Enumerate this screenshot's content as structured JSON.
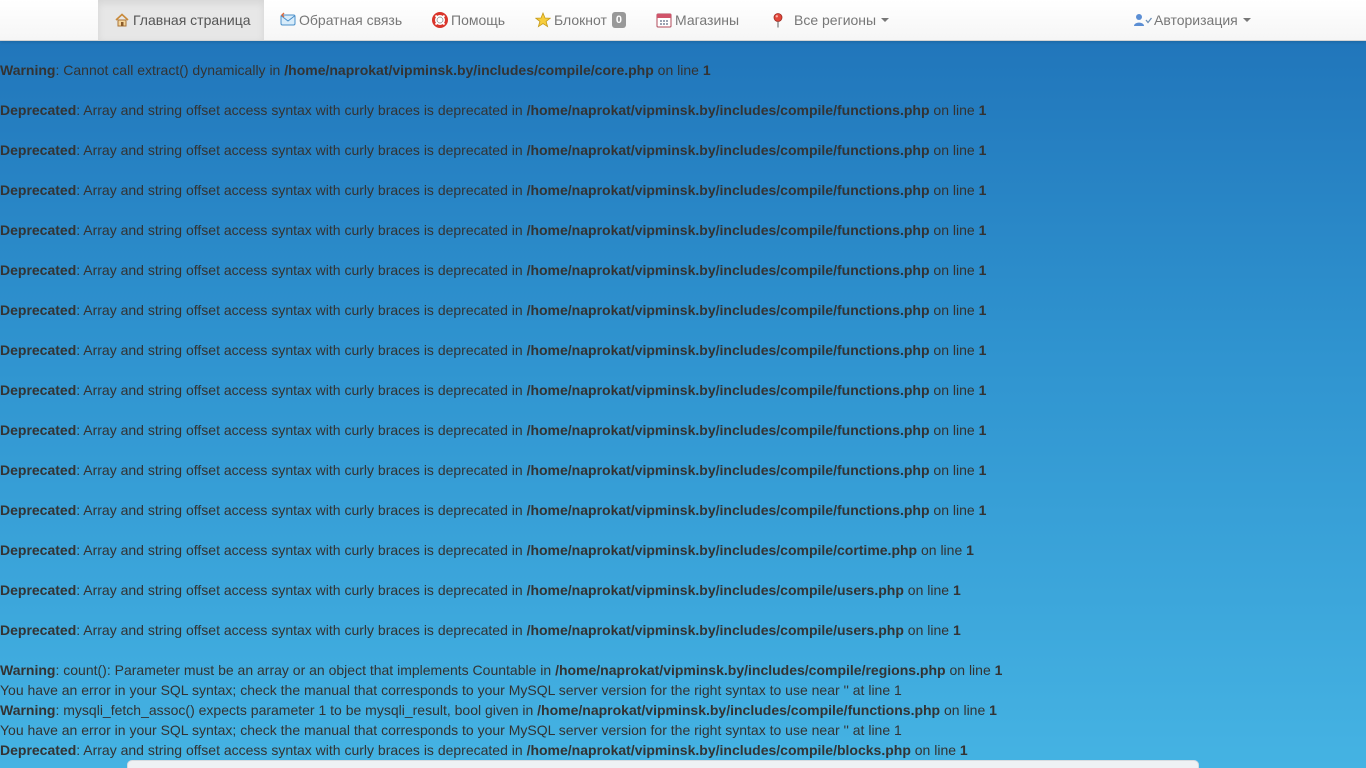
{
  "navbar": {
    "items": [
      {
        "label": "Главная страница",
        "icon": "home-icon",
        "active": true
      },
      {
        "label": "Обратная связь",
        "icon": "feedback-icon",
        "active": false
      },
      {
        "label": "Помощь",
        "icon": "lifebuoy-icon",
        "active": false
      },
      {
        "label": "Блокнот",
        "icon": "star-icon",
        "active": false,
        "badge": "0"
      },
      {
        "label": "Магазины",
        "icon": "calendar-icon",
        "active": false
      },
      {
        "label": "Все регионы",
        "icon": "map-pin-icon",
        "active": false,
        "dropdown": true
      }
    ],
    "auth": {
      "label": "Авторизация",
      "icon": "user-icon",
      "dropdown": true
    }
  },
  "messages": [
    {
      "type": "Warning",
      "text": ": Cannot call extract() dynamically in ",
      "file": "/home/naprokat/vipminsk.by/includes/compile/core.php",
      "on": " on line ",
      "line": "1"
    },
    {
      "type": "Deprecated",
      "text": ": Array and string offset access syntax with curly braces is deprecated in ",
      "file": "/home/naprokat/vipminsk.by/includes/compile/functions.php",
      "on": " on line ",
      "line": "1"
    },
    {
      "type": "Deprecated",
      "text": ": Array and string offset access syntax with curly braces is deprecated in ",
      "file": "/home/naprokat/vipminsk.by/includes/compile/functions.php",
      "on": " on line ",
      "line": "1"
    },
    {
      "type": "Deprecated",
      "text": ": Array and string offset access syntax with curly braces is deprecated in ",
      "file": "/home/naprokat/vipminsk.by/includes/compile/functions.php",
      "on": " on line ",
      "line": "1"
    },
    {
      "type": "Deprecated",
      "text": ": Array and string offset access syntax with curly braces is deprecated in ",
      "file": "/home/naprokat/vipminsk.by/includes/compile/functions.php",
      "on": " on line ",
      "line": "1"
    },
    {
      "type": "Deprecated",
      "text": ": Array and string offset access syntax with curly braces is deprecated in ",
      "file": "/home/naprokat/vipminsk.by/includes/compile/functions.php",
      "on": " on line ",
      "line": "1"
    },
    {
      "type": "Deprecated",
      "text": ": Array and string offset access syntax with curly braces is deprecated in ",
      "file": "/home/naprokat/vipminsk.by/includes/compile/functions.php",
      "on": " on line ",
      "line": "1"
    },
    {
      "type": "Deprecated",
      "text": ": Array and string offset access syntax with curly braces is deprecated in ",
      "file": "/home/naprokat/vipminsk.by/includes/compile/functions.php",
      "on": " on line ",
      "line": "1"
    },
    {
      "type": "Deprecated",
      "text": ": Array and string offset access syntax with curly braces is deprecated in ",
      "file": "/home/naprokat/vipminsk.by/includes/compile/functions.php",
      "on": " on line ",
      "line": "1"
    },
    {
      "type": "Deprecated",
      "text": ": Array and string offset access syntax with curly braces is deprecated in ",
      "file": "/home/naprokat/vipminsk.by/includes/compile/functions.php",
      "on": " on line ",
      "line": "1"
    },
    {
      "type": "Deprecated",
      "text": ": Array and string offset access syntax with curly braces is deprecated in ",
      "file": "/home/naprokat/vipminsk.by/includes/compile/functions.php",
      "on": " on line ",
      "line": "1"
    },
    {
      "type": "Deprecated",
      "text": ": Array and string offset access syntax with curly braces is deprecated in ",
      "file": "/home/naprokat/vipminsk.by/includes/compile/functions.php",
      "on": " on line ",
      "line": "1"
    },
    {
      "type": "Deprecated",
      "text": ": Array and string offset access syntax with curly braces is deprecated in ",
      "file": "/home/naprokat/vipminsk.by/includes/compile/cortime.php",
      "on": " on line ",
      "line": "1"
    },
    {
      "type": "Deprecated",
      "text": ": Array and string offset access syntax with curly braces is deprecated in ",
      "file": "/home/naprokat/vipminsk.by/includes/compile/users.php",
      "on": " on line ",
      "line": "1"
    },
    {
      "type": "Deprecated",
      "text": ": Array and string offset access syntax with curly braces is deprecated in ",
      "file": "/home/naprokat/vipminsk.by/includes/compile/users.php",
      "on": " on line ",
      "line": "1"
    },
    {
      "type": "Warning",
      "text": ": count(): Parameter must be an array or an object that implements Countable in ",
      "file": "/home/naprokat/vipminsk.by/includes/compile/regions.php",
      "on": " on line ",
      "line": "1"
    }
  ],
  "sql_error_1": "You have an error in your SQL syntax; check the manual that corresponds to your MySQL server version for the right syntax to use near '' at line 1",
  "warning_fetch": {
    "type": "Warning",
    "text": ": mysqli_fetch_assoc() expects parameter 1 to be mysqli_result, bool given in ",
    "file": "/home/naprokat/vipminsk.by/includes/compile/functions.php",
    "on": " on line ",
    "line": "1"
  },
  "sql_error_2": "You have an error in your SQL syntax; check the manual that corresponds to your MySQL server version for the right syntax to use near '' at line 1",
  "last_deprecated": {
    "type": "Deprecated",
    "text": ": Array and string offset access syntax with curly braces is deprecated in ",
    "file": "/home/naprokat/vipminsk.by/includes/compile/blocks.php",
    "on": " on line ",
    "line": "1"
  },
  "colors": {
    "background_top": "#1f72b8",
    "background_bottom": "#45b3e3",
    "navbar": "#ffffff",
    "text": "#333333"
  }
}
